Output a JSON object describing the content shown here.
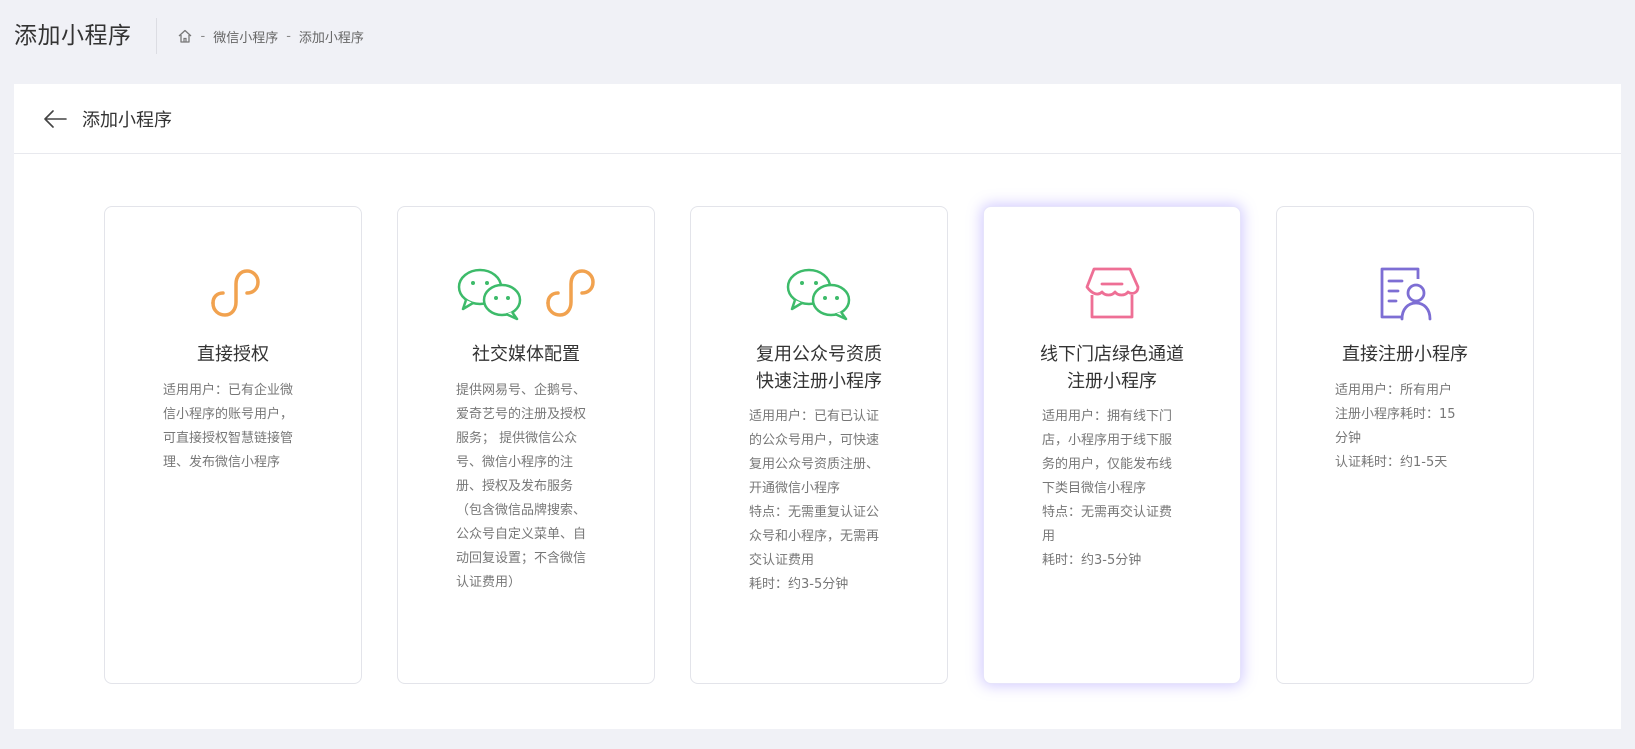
{
  "header": {
    "title": "添加小程序",
    "breadcrumb": {
      "home_icon": "home-icon",
      "separator": "-",
      "items": [
        "微信小程序",
        "添加小程序"
      ]
    }
  },
  "panel": {
    "back_icon": "arrow-left-icon",
    "title": "添加小程序"
  },
  "colors": {
    "orange": "#f1a24f",
    "green": "#3dbb6a",
    "pink": "#ee6f95",
    "purple": "#7d6ed4",
    "active_glow": "#8e7bff"
  },
  "cards": [
    {
      "title": "直接授权",
      "icons": [
        "mini-program-link-icon"
      ],
      "desc": "适用用户：已有企业微\n信小程序的账号用户，\n可直接授权智慧链接管\n理、发布微信小程序"
    },
    {
      "title": "社交媒体配置",
      "icons": [
        "wechat-icon",
        "mini-program-link-icon"
      ],
      "desc": "提供网易号、企鹅号、\n爱奇艺号的注册及授权\n服务；   提供微信公众\n号、微信小程序的注\n册、授权及发布服务\n（包含微信品牌搜索、\n公众号自定义菜单、自\n动回复设置；不含微信\n认证费用）"
    },
    {
      "title": "复用公众号资质\n快速注册小程序",
      "icons": [
        "wechat-icon"
      ],
      "desc": "适用用户：已有已认证\n的公众号用户，可快速\n复用公众号资质注册、\n开通微信小程序\n特点：无需重复认证公\n众号和小程序，无需再\n交认证费用\n耗时：约3-5分钟"
    },
    {
      "title": "线下门店绿色通道\n注册小程序",
      "icons": [
        "store-icon"
      ],
      "desc": "适用用户：拥有线下门\n店，小程序用于线下服\n务的用户，仅能发布线\n下类目微信小程序\n特点：无需再交认证费\n用\n耗时：约3-5分钟",
      "active": true
    },
    {
      "title": "直接注册小程序",
      "icons": [
        "user-profile-icon"
      ],
      "desc": "适用用户：所有用户\n注册小程序耗时：15\n分钟\n认证耗时：约1-5天"
    }
  ]
}
